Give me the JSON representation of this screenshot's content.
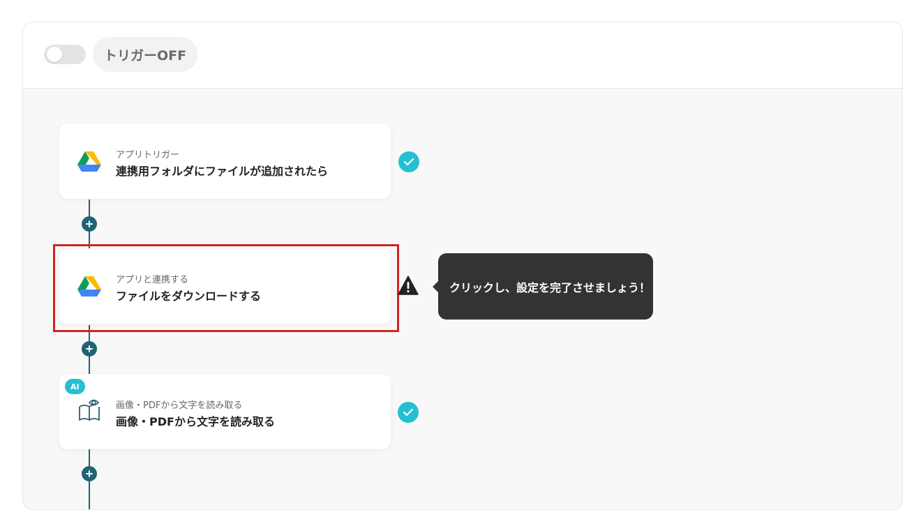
{
  "header": {
    "trigger_toggle_on": false,
    "trigger_label": "トリガーOFF"
  },
  "steps": [
    {
      "sublabel": "アプリトリガー",
      "title": "連携用フォルダにファイルが追加されたら",
      "icon": "google-drive-icon",
      "status": "complete"
    },
    {
      "sublabel": "アプリと連携する",
      "title": "ファイルをダウンロードする",
      "icon": "google-drive-icon",
      "status": "warning",
      "highlighted": true
    },
    {
      "sublabel": "画像・PDFから文字を読み取る",
      "title": "画像・PDFから文字を読み取る",
      "icon": "ocr-book-eye-icon",
      "badge": "AI",
      "status": "complete"
    }
  ],
  "tooltip": {
    "text": "クリックし、設定を完了させましょう！"
  },
  "colors": {
    "accent": "#25bfd2",
    "connector": "#1f6375",
    "highlight": "#d42222",
    "tooltip_bg": "#333333"
  }
}
